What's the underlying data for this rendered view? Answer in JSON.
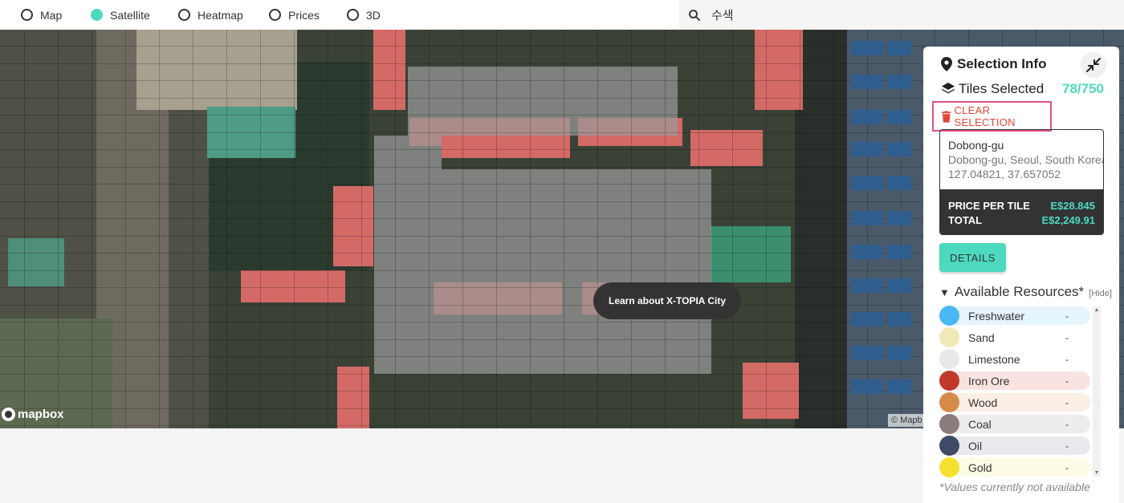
{
  "topbar": {
    "modes": [
      {
        "label": "Map",
        "active": false
      },
      {
        "label": "Satellite",
        "active": true
      },
      {
        "label": "Heatmap",
        "active": false
      },
      {
        "label": "Prices",
        "active": false
      },
      {
        "label": "3D",
        "active": false
      }
    ],
    "search_value": "수색"
  },
  "map": {
    "logo_text": "mapbox",
    "attribution": "© Mapb",
    "learn_button": "Learn about X-TOPIA City"
  },
  "panel": {
    "title": "Selection Info",
    "tiles_label": "Tiles Selected",
    "tiles_count": "78/750",
    "clear_label": "CLEAR SELECTION",
    "location_name": "Dobong-gu",
    "location_full": "Dobong-gu, Seoul, South Korea",
    "coordinates": "127.04821, 37.657052",
    "price_label": "PRICE PER TILE",
    "price_value": "E$28.845",
    "total_label": "TOTAL",
    "total_value": "E$2,249.91",
    "details_label": "DETAILS",
    "resources_title": "Available Resources*",
    "hide_label": "[Hide]",
    "footnote": "*Values currently not available"
  },
  "resources": [
    {
      "name": "Freshwater",
      "value": "-",
      "color": "#4ab8f5",
      "bg": "#e6f4fd"
    },
    {
      "name": "Sand",
      "value": "-",
      "color": "#efe9b8",
      "bg": "#ffffff"
    },
    {
      "name": "Limestone",
      "value": "-",
      "color": "#e8e8e8",
      "bg": "#ffffff"
    },
    {
      "name": "Iron Ore",
      "value": "-",
      "color": "#c0392b",
      "bg": "#f9e3e1"
    },
    {
      "name": "Wood",
      "value": "-",
      "color": "#d48b47",
      "bg": "#fbeee4"
    },
    {
      "name": "Coal",
      "value": "-",
      "color": "#8b7b7b",
      "bg": "#efecec"
    },
    {
      "name": "Oil",
      "value": "-",
      "color": "#3e4a66",
      "bg": "#e9eaee"
    },
    {
      "name": "Gold",
      "value": "-",
      "color": "#f5e030",
      "bg": "#fdfbe6"
    }
  ]
}
